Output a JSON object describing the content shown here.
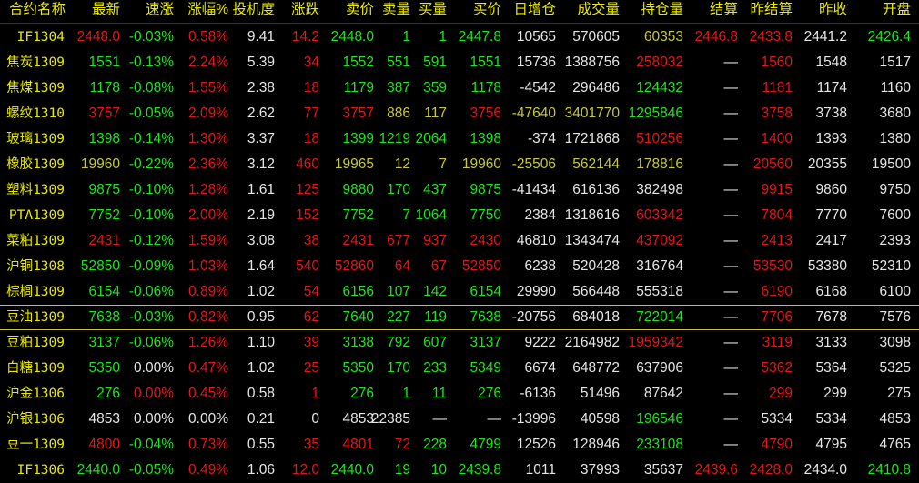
{
  "colors": {
    "r": "#e01818",
    "g": "#22e022",
    "y": "#e8e800",
    "o": "#c8c83a",
    "w": "#e6e6e6",
    "header": "#e8e800",
    "selected_border": "#c8c040"
  },
  "headers": [
    "合约名称",
    "最新",
    "速涨",
    "涨幅%",
    "投机度",
    "涨跌",
    "卖价",
    "卖量",
    "买量",
    "买价",
    "日增仓",
    "成交量",
    "持仓量",
    "结算",
    "昨结算",
    "昨收",
    "开盘"
  ],
  "selected_row": 11,
  "rows": [
    {
      "name": "IF1304",
      "cells": [
        [
          "2448.0",
          "r"
        ],
        [
          "-0.03%",
          "g"
        ],
        [
          "0.58%",
          "r"
        ],
        [
          "9.41",
          "w"
        ],
        [
          "14.2",
          "r"
        ],
        [
          "2448.0",
          "g"
        ],
        [
          "1",
          "g"
        ],
        [
          "1",
          "g"
        ],
        [
          "2447.8",
          "g"
        ],
        [
          "10565",
          "w"
        ],
        [
          "570605",
          "w"
        ],
        [
          "60353",
          "o"
        ],
        [
          "2446.8",
          "r"
        ],
        [
          "2433.8",
          "r"
        ],
        [
          "2441.2",
          "w"
        ],
        [
          "2426.4",
          "g"
        ]
      ]
    },
    {
      "name": "焦炭1309",
      "cells": [
        [
          "1551",
          "g"
        ],
        [
          "-0.13%",
          "g"
        ],
        [
          "2.24%",
          "r"
        ],
        [
          "5.39",
          "w"
        ],
        [
          "34",
          "r"
        ],
        [
          "1552",
          "g"
        ],
        [
          "551",
          "g"
        ],
        [
          "591",
          "g"
        ],
        [
          "1551",
          "g"
        ],
        [
          "15736",
          "w"
        ],
        [
          "1388756",
          "w"
        ],
        [
          "258032",
          "r"
        ],
        [
          "—",
          "w"
        ],
        [
          "1560",
          "r"
        ],
        [
          "1548",
          "w"
        ],
        [
          "1517",
          "w"
        ]
      ]
    },
    {
      "name": "焦煤1309",
      "cells": [
        [
          "1178",
          "g"
        ],
        [
          "-0.08%",
          "g"
        ],
        [
          "1.55%",
          "r"
        ],
        [
          "2.38",
          "w"
        ],
        [
          "18",
          "r"
        ],
        [
          "1179",
          "g"
        ],
        [
          "387",
          "g"
        ],
        [
          "359",
          "g"
        ],
        [
          "1178",
          "g"
        ],
        [
          "-4542",
          "w"
        ],
        [
          "296486",
          "w"
        ],
        [
          "124432",
          "g"
        ],
        [
          "—",
          "w"
        ],
        [
          "1181",
          "r"
        ],
        [
          "1174",
          "w"
        ],
        [
          "1160",
          "w"
        ]
      ]
    },
    {
      "name": "螺纹1310",
      "cells": [
        [
          "3757",
          "r"
        ],
        [
          "-0.05%",
          "g"
        ],
        [
          "2.09%",
          "r"
        ],
        [
          "2.62",
          "w"
        ],
        [
          "77",
          "r"
        ],
        [
          "3757",
          "r"
        ],
        [
          "886",
          "o"
        ],
        [
          "117",
          "o"
        ],
        [
          "3756",
          "r"
        ],
        [
          "-47640",
          "o"
        ],
        [
          "3401770",
          "o"
        ],
        [
          "1295846",
          "g"
        ],
        [
          "—",
          "w"
        ],
        [
          "3758",
          "r"
        ],
        [
          "3738",
          "w"
        ],
        [
          "3680",
          "w"
        ]
      ]
    },
    {
      "name": "玻璃1309",
      "cells": [
        [
          "1398",
          "g"
        ],
        [
          "-0.14%",
          "g"
        ],
        [
          "1.30%",
          "r"
        ],
        [
          "3.37",
          "w"
        ],
        [
          "18",
          "r"
        ],
        [
          "1399",
          "g"
        ],
        [
          "1219",
          "g"
        ],
        [
          "2064",
          "g"
        ],
        [
          "1398",
          "g"
        ],
        [
          "-374",
          "w"
        ],
        [
          "1721868",
          "w"
        ],
        [
          "510256",
          "r"
        ],
        [
          "—",
          "w"
        ],
        [
          "1400",
          "r"
        ],
        [
          "1393",
          "w"
        ],
        [
          "1380",
          "w"
        ]
      ]
    },
    {
      "name": "橡胶1309",
      "cells": [
        [
          "19960",
          "o"
        ],
        [
          "-0.22%",
          "g"
        ],
        [
          "2.36%",
          "r"
        ],
        [
          "3.12",
          "w"
        ],
        [
          "460",
          "r"
        ],
        [
          "19965",
          "o"
        ],
        [
          "12",
          "o"
        ],
        [
          "7",
          "o"
        ],
        [
          "19960",
          "o"
        ],
        [
          "-25506",
          "o"
        ],
        [
          "562144",
          "o"
        ],
        [
          "178816",
          "o"
        ],
        [
          "—",
          "w"
        ],
        [
          "20560",
          "r"
        ],
        [
          "20355",
          "w"
        ],
        [
          "19500",
          "w"
        ]
      ]
    },
    {
      "name": "塑料1309",
      "cells": [
        [
          "9875",
          "g"
        ],
        [
          "-0.10%",
          "g"
        ],
        [
          "1.28%",
          "r"
        ],
        [
          "1.61",
          "w"
        ],
        [
          "125",
          "r"
        ],
        [
          "9880",
          "g"
        ],
        [
          "170",
          "g"
        ],
        [
          "437",
          "g"
        ],
        [
          "9875",
          "g"
        ],
        [
          "-41434",
          "w"
        ],
        [
          "616136",
          "w"
        ],
        [
          "382498",
          "w"
        ],
        [
          "—",
          "w"
        ],
        [
          "9915",
          "r"
        ],
        [
          "9860",
          "w"
        ],
        [
          "9750",
          "w"
        ]
      ]
    },
    {
      "name": "PTA1309",
      "cells": [
        [
          "7752",
          "g"
        ],
        [
          "-0.10%",
          "g"
        ],
        [
          "2.00%",
          "r"
        ],
        [
          "2.19",
          "w"
        ],
        [
          "152",
          "r"
        ],
        [
          "7752",
          "g"
        ],
        [
          "7",
          "g"
        ],
        [
          "1064",
          "g"
        ],
        [
          "7750",
          "g"
        ],
        [
          "2384",
          "w"
        ],
        [
          "1318616",
          "w"
        ],
        [
          "603342",
          "r"
        ],
        [
          "—",
          "w"
        ],
        [
          "7804",
          "r"
        ],
        [
          "7770",
          "w"
        ],
        [
          "7600",
          "w"
        ]
      ]
    },
    {
      "name": "菜粕1309",
      "cells": [
        [
          "2431",
          "r"
        ],
        [
          "-0.12%",
          "g"
        ],
        [
          "1.59%",
          "r"
        ],
        [
          "3.08",
          "w"
        ],
        [
          "38",
          "r"
        ],
        [
          "2431",
          "r"
        ],
        [
          "677",
          "r"
        ],
        [
          "937",
          "r"
        ],
        [
          "2430",
          "r"
        ],
        [
          "46810",
          "w"
        ],
        [
          "1343474",
          "w"
        ],
        [
          "437092",
          "r"
        ],
        [
          "—",
          "w"
        ],
        [
          "2413",
          "r"
        ],
        [
          "2417",
          "w"
        ],
        [
          "2393",
          "w"
        ]
      ]
    },
    {
      "name": "沪铜1308",
      "cells": [
        [
          "52850",
          "g"
        ],
        [
          "-0.09%",
          "g"
        ],
        [
          "1.03%",
          "r"
        ],
        [
          "1.64",
          "w"
        ],
        [
          "540",
          "r"
        ],
        [
          "52860",
          "r"
        ],
        [
          "64",
          "r"
        ],
        [
          "67",
          "r"
        ],
        [
          "52850",
          "r"
        ],
        [
          "6238",
          "w"
        ],
        [
          "520428",
          "w"
        ],
        [
          "316764",
          "w"
        ],
        [
          "—",
          "w"
        ],
        [
          "53530",
          "r"
        ],
        [
          "53380",
          "w"
        ],
        [
          "52310",
          "w"
        ]
      ]
    },
    {
      "name": "棕榈1309",
      "cells": [
        [
          "6154",
          "g"
        ],
        [
          "-0.06%",
          "g"
        ],
        [
          "0.89%",
          "r"
        ],
        [
          "1.02",
          "w"
        ],
        [
          "54",
          "r"
        ],
        [
          "6156",
          "g"
        ],
        [
          "107",
          "g"
        ],
        [
          "142",
          "g"
        ],
        [
          "6154",
          "g"
        ],
        [
          "29990",
          "w"
        ],
        [
          "566448",
          "w"
        ],
        [
          "555318",
          "w"
        ],
        [
          "—",
          "w"
        ],
        [
          "6190",
          "r"
        ],
        [
          "6168",
          "w"
        ],
        [
          "6100",
          "w"
        ]
      ]
    },
    {
      "name": "豆油1309",
      "cells": [
        [
          "7638",
          "g"
        ],
        [
          "-0.03%",
          "g"
        ],
        [
          "0.82%",
          "r"
        ],
        [
          "0.95",
          "w"
        ],
        [
          "62",
          "r"
        ],
        [
          "7640",
          "g"
        ],
        [
          "227",
          "g"
        ],
        [
          "119",
          "g"
        ],
        [
          "7638",
          "g"
        ],
        [
          "-20756",
          "w"
        ],
        [
          "684018",
          "w"
        ],
        [
          "722014",
          "g"
        ],
        [
          "—",
          "w"
        ],
        [
          "7706",
          "r"
        ],
        [
          "7678",
          "w"
        ],
        [
          "7576",
          "w"
        ]
      ]
    },
    {
      "name": "豆粕1309",
      "cells": [
        [
          "3137",
          "g"
        ],
        [
          "-0.06%",
          "g"
        ],
        [
          "1.26%",
          "r"
        ],
        [
          "1.10",
          "w"
        ],
        [
          "39",
          "r"
        ],
        [
          "3138",
          "g"
        ],
        [
          "792",
          "g"
        ],
        [
          "607",
          "g"
        ],
        [
          "3137",
          "g"
        ],
        [
          "9222",
          "w"
        ],
        [
          "2164982",
          "w"
        ],
        [
          "1959342",
          "r"
        ],
        [
          "—",
          "w"
        ],
        [
          "3119",
          "r"
        ],
        [
          "3133",
          "w"
        ],
        [
          "3098",
          "w"
        ]
      ]
    },
    {
      "name": "白糖1309",
      "cells": [
        [
          "5350",
          "g"
        ],
        [
          "0.00%",
          "w"
        ],
        [
          "0.47%",
          "r"
        ],
        [
          "1.02",
          "w"
        ],
        [
          "25",
          "r"
        ],
        [
          "5350",
          "g"
        ],
        [
          "170",
          "g"
        ],
        [
          "233",
          "g"
        ],
        [
          "5349",
          "g"
        ],
        [
          "6674",
          "w"
        ],
        [
          "648772",
          "w"
        ],
        [
          "637906",
          "w"
        ],
        [
          "—",
          "w"
        ],
        [
          "5362",
          "r"
        ],
        [
          "5364",
          "w"
        ],
        [
          "5325",
          "w"
        ]
      ]
    },
    {
      "name": "沪金1306",
      "cells": [
        [
          "276",
          "g"
        ],
        [
          "0.00%",
          "r"
        ],
        [
          "0.45%",
          "r"
        ],
        [
          "0.58",
          "w"
        ],
        [
          "1",
          "r"
        ],
        [
          "276",
          "g"
        ],
        [
          "1",
          "g"
        ],
        [
          "11",
          "g"
        ],
        [
          "276",
          "g"
        ],
        [
          "-6136",
          "w"
        ],
        [
          "51496",
          "w"
        ],
        [
          "87642",
          "w"
        ],
        [
          "—",
          "w"
        ],
        [
          "299",
          "r"
        ],
        [
          "299",
          "w"
        ],
        [
          "275",
          "w"
        ]
      ]
    },
    {
      "name": "沪银1306",
      "cells": [
        [
          "4853",
          "w"
        ],
        [
          "0.00%",
          "w"
        ],
        [
          "0.00%",
          "w"
        ],
        [
          "0.21",
          "w"
        ],
        [
          "0",
          "w"
        ],
        [
          "4853",
          "w"
        ],
        [
          "22385",
          "w"
        ],
        [
          "—",
          "w"
        ],
        [
          "—",
          "w"
        ],
        [
          "-13996",
          "w"
        ],
        [
          "40598",
          "w"
        ],
        [
          "196546",
          "g"
        ],
        [
          "—",
          "w"
        ],
        [
          "5334",
          "w"
        ],
        [
          "5334",
          "w"
        ],
        [
          "4853",
          "w"
        ]
      ]
    },
    {
      "name": "豆一1309",
      "cells": [
        [
          "4800",
          "r"
        ],
        [
          "-0.04%",
          "g"
        ],
        [
          "0.73%",
          "r"
        ],
        [
          "0.55",
          "w"
        ],
        [
          "35",
          "r"
        ],
        [
          "4801",
          "r"
        ],
        [
          "72",
          "r"
        ],
        [
          "228",
          "g"
        ],
        [
          "4799",
          "g"
        ],
        [
          "12526",
          "w"
        ],
        [
          "128946",
          "w"
        ],
        [
          "233108",
          "g"
        ],
        [
          "—",
          "w"
        ],
        [
          "4790",
          "r"
        ],
        [
          "4795",
          "w"
        ],
        [
          "4765",
          "w"
        ]
      ]
    },
    {
      "name": "IF1306",
      "cells": [
        [
          "2440.0",
          "g"
        ],
        [
          "-0.05%",
          "g"
        ],
        [
          "0.49%",
          "r"
        ],
        [
          "1.06",
          "w"
        ],
        [
          "12.0",
          "r"
        ],
        [
          "2440.0",
          "g"
        ],
        [
          "19",
          "g"
        ],
        [
          "10",
          "g"
        ],
        [
          "2439.8",
          "g"
        ],
        [
          "1011",
          "w"
        ],
        [
          "37993",
          "w"
        ],
        [
          "35637",
          "w"
        ],
        [
          "2439.6",
          "r"
        ],
        [
          "2428.0",
          "r"
        ],
        [
          "2434.0",
          "w"
        ],
        [
          "2410.8",
          "g"
        ]
      ]
    }
  ]
}
